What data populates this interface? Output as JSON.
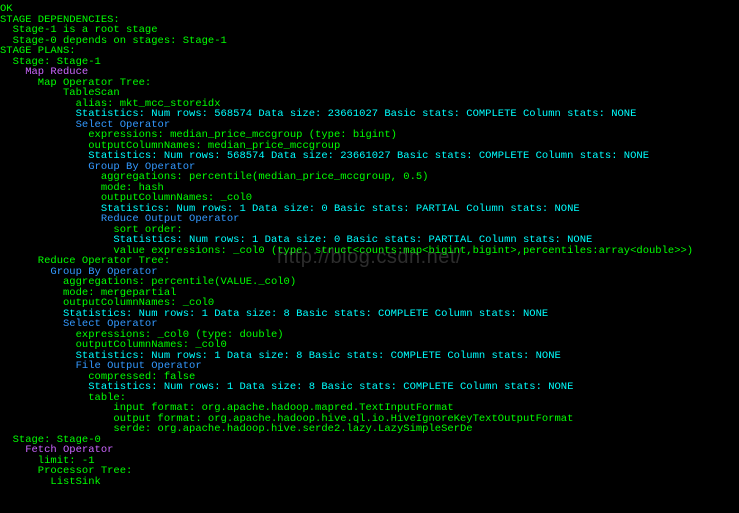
{
  "watermark": "http://blog.csdn.net/",
  "lines": [
    {
      "indent": 0,
      "cls": "c-green",
      "text": "OK"
    },
    {
      "indent": 0,
      "cls": "c-green",
      "text": "STAGE DEPENDENCIES:"
    },
    {
      "indent": 2,
      "cls": "c-green",
      "text": "Stage-1 is a root stage"
    },
    {
      "indent": 2,
      "cls": "c-green",
      "text": "Stage-0 depends on stages: Stage-1"
    },
    {
      "indent": 0,
      "cls": "c-green",
      "text": ""
    },
    {
      "indent": 0,
      "cls": "c-green",
      "text": "STAGE PLANS:"
    },
    {
      "indent": 2,
      "cls": "c-green",
      "text": "Stage: Stage-1"
    },
    {
      "indent": 4,
      "cls": "c-purple",
      "text": "Map Reduce"
    },
    {
      "indent": 6,
      "cls": "c-green",
      "text": "Map Operator Tree:"
    },
    {
      "indent": 10,
      "cls": "c-green",
      "text": "TableScan"
    },
    {
      "indent": 12,
      "cls": "c-green",
      "text": "alias: mkt_mcc_storeidx"
    },
    {
      "indent": 12,
      "cls": "c-cyan",
      "text": "Statistics: Num rows: 568574 Data size: 23661027 Basic stats: COMPLETE Column stats: NONE"
    },
    {
      "indent": 12,
      "cls": "c-blue",
      "text": "Select Operator"
    },
    {
      "indent": 14,
      "cls": "c-green",
      "text": "expressions: median_price_mccgroup (type: bigint)"
    },
    {
      "indent": 14,
      "cls": "c-green",
      "text": "outputColumnNames: median_price_mccgroup"
    },
    {
      "indent": 14,
      "cls": "c-cyan",
      "text": "Statistics: Num rows: 568574 Data size: 23661027 Basic stats: COMPLETE Column stats: NONE"
    },
    {
      "indent": 14,
      "cls": "c-blue",
      "text": "Group By Operator"
    },
    {
      "indent": 16,
      "cls": "c-green",
      "text": "aggregations: percentile(median_price_mccgroup, 0.5)"
    },
    {
      "indent": 16,
      "cls": "c-green",
      "text": "mode: hash"
    },
    {
      "indent": 16,
      "cls": "c-green",
      "text": "outputColumnNames: _col0"
    },
    {
      "indent": 16,
      "cls": "c-cyan",
      "text": "Statistics: Num rows: 1 Data size: 0 Basic stats: PARTIAL Column stats: NONE"
    },
    {
      "indent": 16,
      "cls": "c-blue",
      "text": "Reduce Output Operator"
    },
    {
      "indent": 18,
      "cls": "c-green",
      "text": "sort order:"
    },
    {
      "indent": 18,
      "cls": "c-cyan",
      "text": "Statistics: Num rows: 1 Data size: 0 Basic stats: PARTIAL Column stats: NONE"
    },
    {
      "indent": 18,
      "cls": "c-green",
      "text": "value expressions: _col0 (type: struct<counts:map<bigint,bigint>,percentiles:array<double>>)"
    },
    {
      "indent": 6,
      "cls": "c-green",
      "text": "Reduce Operator Tree:"
    },
    {
      "indent": 8,
      "cls": "c-blue",
      "text": "Group By Operator"
    },
    {
      "indent": 10,
      "cls": "c-green",
      "text": "aggregations: percentile(VALUE._col0)"
    },
    {
      "indent": 10,
      "cls": "c-green",
      "text": "mode: mergepartial"
    },
    {
      "indent": 10,
      "cls": "c-green",
      "text": "outputColumnNames: _col0"
    },
    {
      "indent": 10,
      "cls": "c-cyan",
      "text": "Statistics: Num rows: 1 Data size: 8 Basic stats: COMPLETE Column stats: NONE"
    },
    {
      "indent": 10,
      "cls": "c-blue",
      "text": "Select Operator"
    },
    {
      "indent": 12,
      "cls": "c-green",
      "text": "expressions: _col0 (type: double)"
    },
    {
      "indent": 12,
      "cls": "c-green",
      "text": "outputColumnNames: _col0"
    },
    {
      "indent": 12,
      "cls": "c-cyan",
      "text": "Statistics: Num rows: 1 Data size: 8 Basic stats: COMPLETE Column stats: NONE"
    },
    {
      "indent": 12,
      "cls": "c-blue",
      "text": "File Output Operator"
    },
    {
      "indent": 14,
      "cls": "c-green",
      "text": "compressed: false"
    },
    {
      "indent": 14,
      "cls": "c-cyan",
      "text": "Statistics: Num rows: 1 Data size: 8 Basic stats: COMPLETE Column stats: NONE"
    },
    {
      "indent": 14,
      "cls": "c-green",
      "text": "table:"
    },
    {
      "indent": 18,
      "cls": "c-green",
      "text": "input format: org.apache.hadoop.mapred.TextInputFormat"
    },
    {
      "indent": 18,
      "cls": "c-green",
      "text": "output format: org.apache.hadoop.hive.ql.io.HiveIgnoreKeyTextOutputFormat"
    },
    {
      "indent": 18,
      "cls": "c-green",
      "text": "serde: org.apache.hadoop.hive.serde2.lazy.LazySimpleSerDe"
    },
    {
      "indent": 0,
      "cls": "c-green",
      "text": ""
    },
    {
      "indent": 2,
      "cls": "c-green",
      "text": "Stage: Stage-0"
    },
    {
      "indent": 4,
      "cls": "c-purple",
      "text": "Fetch Operator"
    },
    {
      "indent": 6,
      "cls": "c-green",
      "text": "limit: -1"
    },
    {
      "indent": 6,
      "cls": "c-green",
      "text": "Processor Tree:"
    },
    {
      "indent": 8,
      "cls": "c-green",
      "text": "ListSink"
    }
  ]
}
